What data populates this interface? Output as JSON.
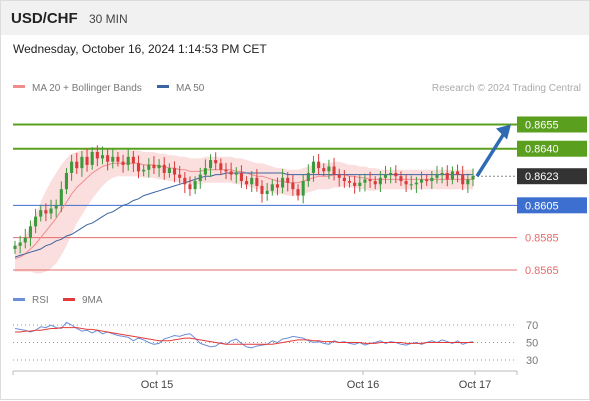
{
  "header": {
    "symbol": "USD/CHF",
    "timeframe": "30 MIN"
  },
  "datetime": "Wednesday, October 16, 2024 1:14:53 PM CET",
  "colors": {
    "resistance": "#5aa01e",
    "support": "#3d6fd1",
    "support_secondary": "#e46c6c",
    "current": "#333333",
    "bull_candle": "#3c9a3c",
    "bear_candle": "#d93b3b",
    "ma20": "#f08c8c",
    "bollinger_fill": "#fbdede",
    "ma50": "#3c64a0",
    "arrow": "#2e6bb3",
    "rsi": "#6b8fd6",
    "rsi_ma": "#e33b3b"
  },
  "chart_data": [
    {
      "type": "candlestick",
      "legend": [
        "MA 20 + Bollinger Bands",
        "MA 50"
      ],
      "credit": "Research © 2024 Trading Central",
      "x_ticks": [
        "Oct 15",
        "Oct 16",
        "Oct 17"
      ],
      "ylim": [
        0.8552,
        0.8672
      ],
      "levels": [
        {
          "label": "0.8655",
          "value": 0.8655,
          "kind": "resistance"
        },
        {
          "label": "0.8640",
          "value": 0.864,
          "kind": "resistance"
        },
        {
          "label": "0.8623",
          "value": 0.8623,
          "kind": "current"
        },
        {
          "label": "0.8605",
          "value": 0.8605,
          "kind": "support"
        },
        {
          "label": "0.8585",
          "value": 0.8585,
          "kind": "support_secondary"
        },
        {
          "label": "0.8565",
          "value": 0.8565,
          "kind": "support_secondary"
        }
      ],
      "close": [
        0.858,
        0.8582,
        0.8585,
        0.8592,
        0.8598,
        0.8602,
        0.86,
        0.8603,
        0.8605,
        0.8615,
        0.8625,
        0.8632,
        0.8628,
        0.8635,
        0.863,
        0.8638,
        0.8634,
        0.8636,
        0.8632,
        0.8635,
        0.8632,
        0.863,
        0.8635,
        0.8631,
        0.8626,
        0.8627,
        0.863,
        0.8628,
        0.863,
        0.8625,
        0.8628,
        0.8624,
        0.8622,
        0.8618,
        0.8615,
        0.862,
        0.8624,
        0.8628,
        0.8633,
        0.8631,
        0.8627,
        0.8626,
        0.8624,
        0.8625,
        0.862,
        0.8618,
        0.8622,
        0.8617,
        0.8612,
        0.8614,
        0.8618,
        0.8616,
        0.8622,
        0.8619,
        0.8615,
        0.8611,
        0.862,
        0.8625,
        0.8632,
        0.8628,
        0.8626,
        0.8629,
        0.8624,
        0.8622,
        0.862,
        0.8619,
        0.8617,
        0.8619,
        0.8621,
        0.862,
        0.8618,
        0.8622,
        0.8624,
        0.8625,
        0.8623,
        0.862,
        0.8618,
        0.8618,
        0.8619,
        0.8621,
        0.862,
        0.8622,
        0.8624,
        0.8625,
        0.8621,
        0.8626,
        0.8624,
        0.8618,
        0.8621,
        0.8623
      ],
      "ma20": [
        0.8572,
        0.8573,
        0.8575,
        0.8578,
        0.8581,
        0.8585,
        0.8589,
        0.8593,
        0.8597,
        0.8602,
        0.8607,
        0.8612,
        0.8616,
        0.8619,
        0.8622,
        0.8625,
        0.8627,
        0.8629,
        0.863,
        0.8631,
        0.8631,
        0.8631,
        0.8631,
        0.8631,
        0.8631,
        0.863,
        0.863,
        0.863,
        0.8629,
        0.8629,
        0.8628,
        0.8628,
        0.8627,
        0.8627,
        0.8626,
        0.8626,
        0.8626,
        0.8627,
        0.8627,
        0.8627,
        0.8627,
        0.8627,
        0.8627,
        0.8626,
        0.8626,
        0.8625,
        0.8624,
        0.8623,
        0.8623,
        0.8622,
        0.8621,
        0.862,
        0.862,
        0.8619,
        0.8619,
        0.8619,
        0.862,
        0.8621,
        0.8622,
        0.8623,
        0.8623,
        0.8623,
        0.8624,
        0.8624,
        0.8624,
        0.8623,
        0.8623,
        0.8622,
        0.8622,
        0.8621,
        0.8621,
        0.8621,
        0.8621,
        0.8621,
        0.8621,
        0.8621,
        0.8621,
        0.8621,
        0.8621,
        0.8621,
        0.8621,
        0.8621,
        0.8621,
        0.8621,
        0.8621,
        0.8621,
        0.8621,
        0.8621,
        0.8621,
        0.8621
      ],
      "bb_width": [
        0.0008,
        0.0009,
        0.0011,
        0.0014,
        0.0018,
        0.0022,
        0.0025,
        0.0027,
        0.0028,
        0.0028,
        0.0027,
        0.0025,
        0.0022,
        0.002,
        0.0018,
        0.0016,
        0.0014,
        0.0012,
        0.001,
        0.0009,
        0.0008,
        0.0008,
        0.0008,
        0.0008,
        0.0008,
        0.0008,
        0.0008,
        0.0008,
        0.0008,
        0.0008,
        0.0008,
        0.0008,
        0.0008,
        0.0008,
        0.0008,
        0.0008,
        0.0008,
        0.0008,
        0.0008,
        0.0008,
        0.0008,
        0.0008,
        0.0008,
        0.0008,
        0.0008,
        0.0008,
        0.0008,
        0.0008,
        0.0008,
        0.0008,
        0.0008,
        0.0008,
        0.0008,
        0.0008,
        0.0008,
        0.0008,
        0.0008,
        0.0008,
        0.0008,
        0.0008,
        0.0008,
        0.0008,
        0.0008,
        0.0008,
        0.0007,
        0.0007,
        0.0007,
        0.0007,
        0.0007,
        0.0007,
        0.0007,
        0.0006,
        0.0006,
        0.0006,
        0.0006,
        0.0006,
        0.0006,
        0.0006,
        0.0006,
        0.0006,
        0.0006,
        0.0006,
        0.0006,
        0.0006,
        0.0006,
        0.0006,
        0.0006,
        0.0006,
        0.0006,
        0.0006
      ],
      "ma50": [
        0.8573,
        0.8574,
        0.8575,
        0.8576,
        0.8577,
        0.8578,
        0.858,
        0.8581,
        0.8583,
        0.8584,
        0.8586,
        0.8587,
        0.8589,
        0.8591,
        0.8593,
        0.8594,
        0.8596,
        0.8598,
        0.86,
        0.8601,
        0.8603,
        0.8605,
        0.8606,
        0.8608,
        0.8609,
        0.8611,
        0.8612,
        0.8613,
        0.8614,
        0.8615,
        0.8616,
        0.8617,
        0.8618,
        0.8619,
        0.862,
        0.8621,
        0.8622,
        0.8623,
        0.8623,
        0.8624,
        0.8624,
        0.8625,
        0.8625,
        0.8625,
        0.8625,
        0.8625,
        0.8625,
        0.8625,
        0.8625,
        0.8625,
        0.8625,
        0.8625,
        0.8625,
        0.8624,
        0.8624,
        0.8624,
        0.8624,
        0.8624,
        0.8624,
        0.8624,
        0.8624,
        0.8624,
        0.8624,
        0.8624,
        0.8624,
        0.8624,
        0.8624,
        0.8624,
        0.8624,
        0.8624,
        0.8624,
        0.8624,
        0.8624,
        0.8624,
        0.8624,
        0.8624,
        0.8624,
        0.8624,
        0.8624,
        0.8624,
        0.8624,
        0.8624,
        0.8624,
        0.8624,
        0.8624,
        0.8624,
        0.8624,
        0.8624,
        0.8624,
        0.8624
      ],
      "projection": {
        "to": 0.8655
      }
    },
    {
      "type": "line",
      "legend": [
        "RSI",
        "9MA"
      ],
      "y_ticks": [
        70,
        50,
        30
      ],
      "ylim": [
        25,
        78
      ],
      "series": [
        {
          "name": "RSI",
          "values": [
            66,
            65,
            64,
            62,
            64,
            68,
            67,
            70,
            67,
            66,
            73,
            70,
            66,
            63,
            64,
            61,
            64,
            60,
            62,
            60,
            58,
            57,
            56,
            52,
            55,
            53,
            50,
            48,
            49,
            54,
            56,
            58,
            57,
            59,
            60,
            55,
            49,
            47,
            45,
            46,
            50,
            48,
            52,
            54,
            49,
            45,
            44,
            46,
            47,
            48,
            52,
            50,
            54,
            55,
            57,
            56,
            55,
            52,
            50,
            51,
            49,
            48,
            52,
            50,
            51,
            49,
            48,
            50,
            47,
            49,
            50,
            52,
            49,
            51,
            50,
            48,
            47,
            49,
            50,
            48,
            50,
            52,
            50,
            53,
            51,
            49,
            52,
            48,
            50,
            51
          ]
        },
        {
          "name": "9MA",
          "values": [
            62,
            62,
            63,
            63,
            64,
            64,
            65,
            66,
            66,
            67,
            67,
            67,
            67,
            66,
            65,
            65,
            64,
            63,
            62,
            61,
            60,
            59,
            58,
            57,
            56,
            55,
            54,
            53,
            52,
            52,
            52,
            53,
            54,
            55,
            55,
            54,
            53,
            52,
            51,
            50,
            49,
            48,
            48,
            48,
            48,
            48,
            48,
            48,
            48,
            48,
            48,
            49,
            50,
            51,
            52,
            53,
            53,
            53,
            52,
            52,
            51,
            51,
            51,
            50,
            50,
            50,
            50,
            50,
            49,
            49,
            49,
            50,
            50,
            50,
            50,
            50,
            49,
            49,
            49,
            49,
            50,
            50,
            50,
            50,
            50,
            50,
            50,
            50,
            50,
            50
          ]
        }
      ]
    }
  ]
}
